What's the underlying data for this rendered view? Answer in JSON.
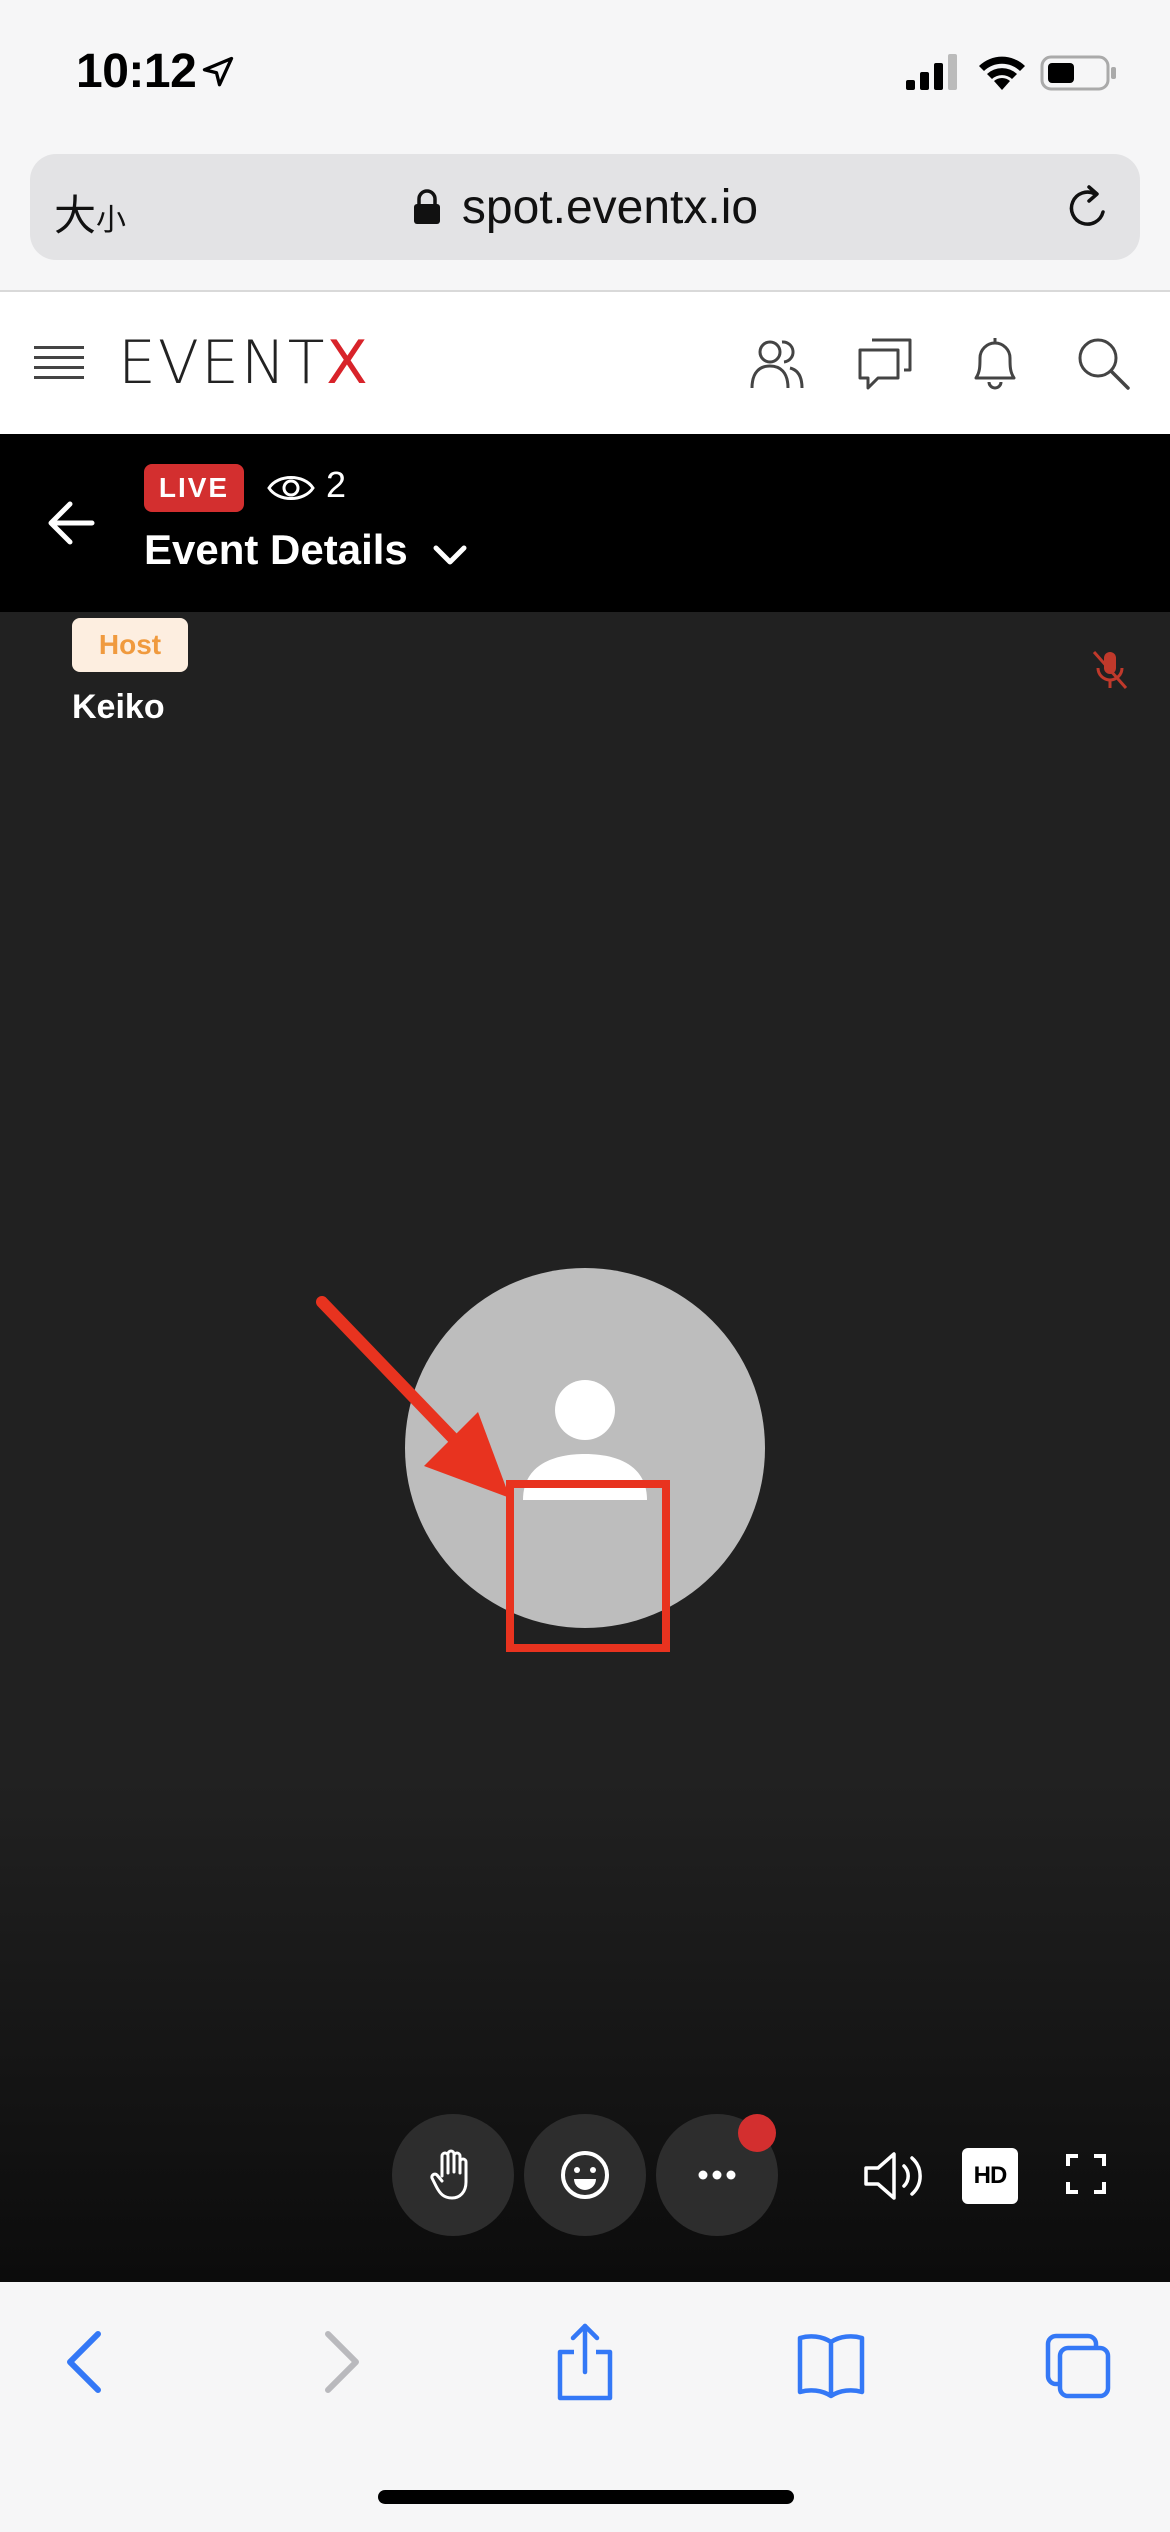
{
  "status_bar": {
    "time": "10:12"
  },
  "browser": {
    "text_size_label": "大",
    "text_size_small": "小",
    "url": "spot.eventx.io"
  },
  "site": {
    "logo_main": "EVENT",
    "logo_accent": "X",
    "accent_color": "#d8232a"
  },
  "event": {
    "live_label": "LIVE",
    "viewer_count": "2",
    "title": "Event Details"
  },
  "stage": {
    "host_badge": "Host",
    "host_name": "Keiko",
    "hd_label": "HD",
    "controls": [
      "raise-hand-icon",
      "reaction-smiley-icon",
      "more-options-icon"
    ]
  },
  "colors": {
    "live_red": "#d32f2f",
    "host_badge_bg": "#fdeee0",
    "host_badge_text": "#f09a3e",
    "annotation_red": "#e8331f",
    "safari_blue": "#3478f6"
  }
}
